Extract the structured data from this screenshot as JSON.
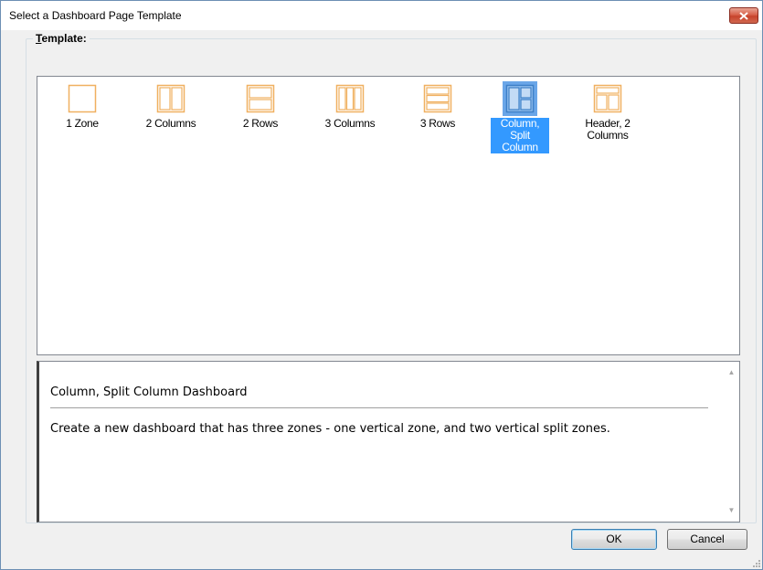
{
  "window": {
    "title": "Select a Dashboard Page Template"
  },
  "template_group": {
    "mnemonic": "T",
    "label_rest": "emplate:"
  },
  "templates": [
    {
      "label": "1 Zone",
      "icon": "one-zone-layout-icon"
    },
    {
      "label": "2 Columns",
      "icon": "two-columns-layout-icon"
    },
    {
      "label": "2 Rows",
      "icon": "two-rows-layout-icon"
    },
    {
      "label": "3 Columns",
      "icon": "three-columns-layout-icon"
    },
    {
      "label": "3 Rows",
      "icon": "three-rows-layout-icon"
    },
    {
      "label": "Column, Split Column",
      "icon": "column-split-column-layout-icon",
      "selected": true
    },
    {
      "label": "Header, 2 Columns",
      "icon": "header-two-columns-layout-icon"
    }
  ],
  "description": {
    "title": "Column, Split Column Dashboard",
    "body": "Create a new dashboard that has three zones - one vertical zone, and two vertical split zones."
  },
  "buttons": {
    "ok": "OK",
    "cancel": "Cancel"
  },
  "colors": {
    "selection": "#3399ff",
    "icon_stroke": "#f0b060",
    "close_button": "#c7432c"
  }
}
